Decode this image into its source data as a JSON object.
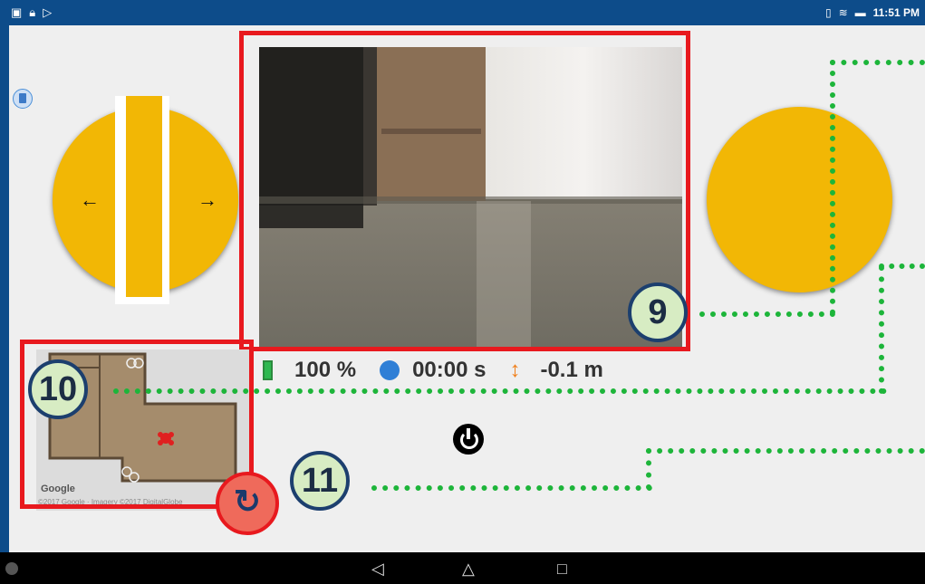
{
  "status_bar": {
    "time": "11:51 PM",
    "left_icons": [
      "app-icon",
      "lock-icon",
      "play-store-icon"
    ],
    "right_icons": [
      "vibrate-icon",
      "wifi-icon",
      "battery-icon"
    ]
  },
  "telemetry": {
    "battery_percent": "100 %",
    "timer": "00:00 s",
    "altitude": "-0.1 m"
  },
  "map": {
    "brand": "Google",
    "copyright": "©2017 Google · Imagery ©2017 DigitalGlobe"
  },
  "joystick_left": {
    "left_arrow": "←",
    "right_arrow": "→"
  },
  "callouts": {
    "camera_callout": "9",
    "map_callout": "10",
    "refresh_callout": "11"
  },
  "nav": {
    "back": "◁",
    "home": "△",
    "recents": "□"
  },
  "colors": {
    "joystick": "#f2b705",
    "highlight_box": "#e8191e",
    "callout_line": "#1db53a",
    "callout_fill": "#d7ecc3",
    "frame": "#0d4c8a"
  }
}
